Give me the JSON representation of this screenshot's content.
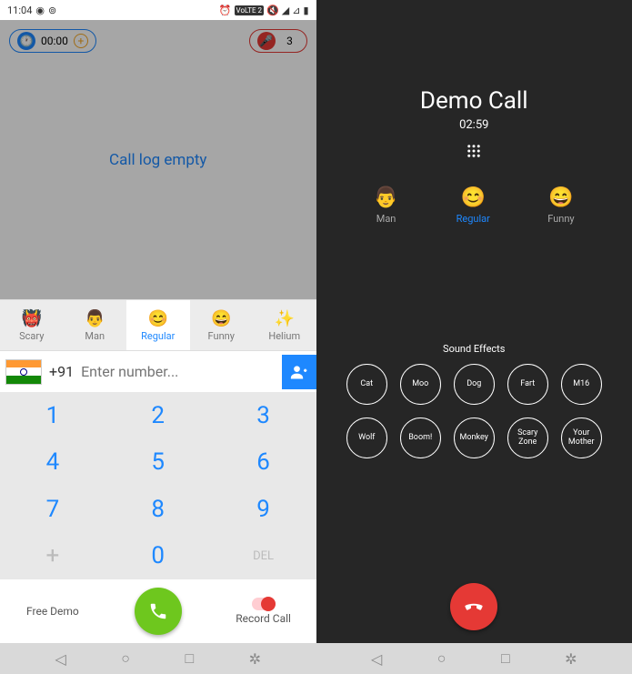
{
  "status": {
    "time": "11:04",
    "volte": "VoLTE 2"
  },
  "left": {
    "timer": "00:00",
    "credits": "3",
    "empty_log": "Call log empty",
    "voices": [
      {
        "label": "Scary"
      },
      {
        "label": "Man"
      },
      {
        "label": "Regular"
      },
      {
        "label": "Funny"
      },
      {
        "label": "Helium"
      }
    ],
    "country_code": "+91",
    "placeholder": "Enter number...",
    "keypad": [
      "1",
      "2",
      "3",
      "4",
      "5",
      "6",
      "7",
      "8",
      "9",
      "+",
      "0",
      "DEL"
    ],
    "free_demo": "Free Demo",
    "record_call": "Record Call"
  },
  "right": {
    "name": "Demo Call",
    "duration": "02:59",
    "voices": [
      {
        "label": "Man"
      },
      {
        "label": "Regular"
      },
      {
        "label": "Funny"
      }
    ],
    "sound_title": "Sound Effects",
    "sounds": [
      "Cat",
      "Moo",
      "Dog",
      "Fart",
      "M16",
      "Wolf",
      "Boom!",
      "Monkey",
      "Scary Zone",
      "Your Mother"
    ]
  }
}
